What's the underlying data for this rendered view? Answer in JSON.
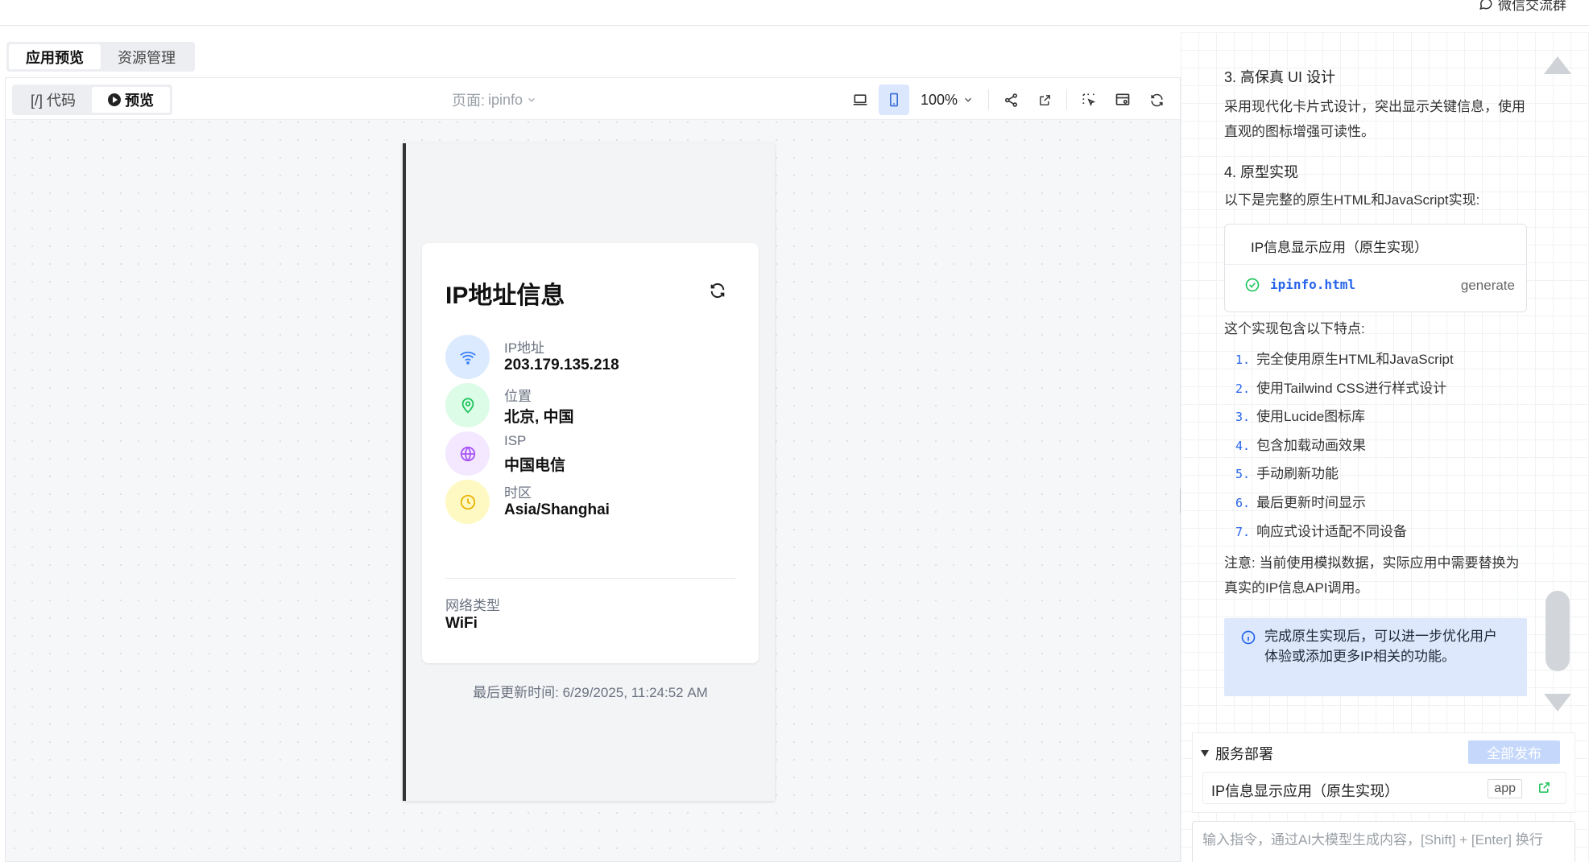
{
  "topbar": {
    "wechat_label": "微信交流群"
  },
  "main_tabs": [
    {
      "label": "应用预览"
    },
    {
      "label": "资源管理"
    }
  ],
  "toolbar": {
    "code_label": "[/] 代码",
    "preview_label": "预览",
    "page_prefix": "页面:",
    "page_value": "ipinfo",
    "zoom": "100%"
  },
  "app": {
    "title": "IP地址信息",
    "rows": [
      {
        "label": "IP地址",
        "value": "203.179.135.218",
        "icon": "wifi-icon",
        "color": "#dbeafe"
      },
      {
        "label": "位置",
        "value": "北京, 中国",
        "icon": "map-pin-icon",
        "color": "#dcfce7"
      },
      {
        "label": "ISP",
        "value": "中国电信",
        "icon": "globe-icon",
        "color": "#f3e8ff"
      },
      {
        "label": "时区",
        "value": "Asia/Shanghai",
        "icon": "clock-icon",
        "color": "#fef9c3"
      }
    ],
    "network_label": "网络类型",
    "network_value": "WiFi",
    "last_update": "最后更新时间: 6/29/2025, 11:24:52 AM"
  },
  "chat": {
    "cut_text": "...",
    "h3": "3. 高保真 UI 设计",
    "p3": "采用现代化卡片式设计，突出显示关键信息，使用直观的图标增强可读性。",
    "h4": "4. 原型实现",
    "p4": "以下是完整的原生HTML和JavaScript实现:",
    "file_card_title": "IP信息显示应用（原生实现）",
    "file_name": "ipinfo.html",
    "file_action": "generate",
    "features_intro": "这个实现包含以下特点:",
    "features": [
      "完全使用原生HTML和JavaScript",
      "使用Tailwind CSS进行样式设计",
      "使用Lucide图标库",
      "包含加载动画效果",
      "手动刷新功能",
      "最后更新时间显示",
      "响应式设计适配不同设备"
    ],
    "feature_nums": [
      "1.",
      "2.",
      "3.",
      "4.",
      "5.",
      "6.",
      "7."
    ],
    "note": "注意: 当前使用模拟数据，实际应用中需要替换为真实的IP信息API调用。",
    "notice": "完成原生实现后，可以进一步优化用户体验或添加更多IP相关的功能。"
  },
  "deploy": {
    "title": "服务部署",
    "publish_all": "全部发布",
    "item_name": "IP信息显示应用（原生实现）",
    "item_tag": "app"
  },
  "input": {
    "placeholder": "输入指令，通过AI大模型生成内容，[Shift] + [Enter] 换行"
  }
}
